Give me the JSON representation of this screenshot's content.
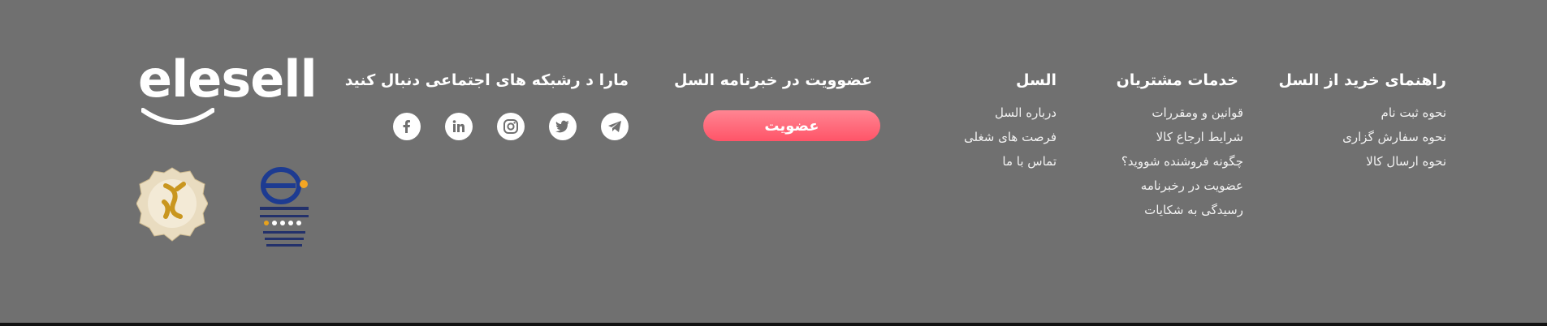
{
  "logo": {
    "text": "elesell"
  },
  "columns": {
    "guide": {
      "title": "راهنمای خرید از السل",
      "links": [
        "نحوه ثبت نام",
        "نحوه سفارش گزاری",
        "نحوه ارسال کالا"
      ]
    },
    "services": {
      "title": "خدمات مشتریان",
      "links": [
        "قوانین و ومقررات",
        "شرایط ارجاع کالا",
        "چگونه فروشنده شووید؟",
        "عضویت در رخبرنامه",
        "رسیدگی به شکایات"
      ]
    },
    "about": {
      "title": "السل",
      "links": [
        "درباره السل",
        "فرصت های شغلی",
        "تماس با ما"
      ]
    }
  },
  "newsletter": {
    "title": "عضوویت در خبرنامه السل",
    "button_label": "عضویت"
  },
  "social": {
    "title": "مارا د رشبکه های اجتماعی دنبال کنید",
    "icons": [
      "telegram-icon",
      "twitter-icon",
      "instagram-icon",
      "linkedin-icon",
      "facebook-icon"
    ]
  },
  "badges": [
    "enamad-badge",
    "samandehi-badge"
  ],
  "colors": {
    "background": "#707070",
    "button_gradient_top": "#ff8592",
    "button_gradient_bottom": "#ff5468",
    "text": "#ffffff"
  }
}
